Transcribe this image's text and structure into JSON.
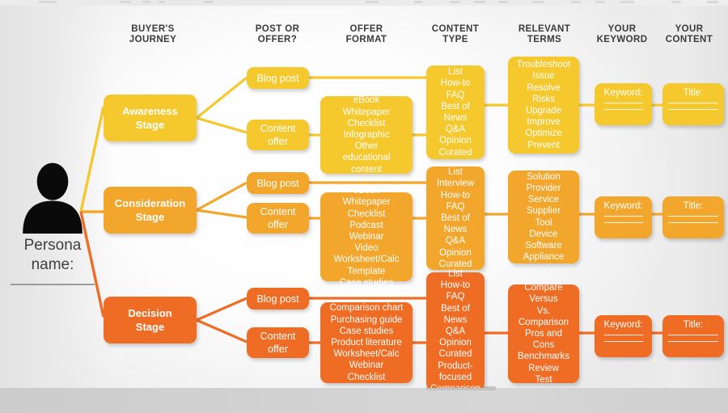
{
  "document": {
    "type": "buyer-journey-content-mapping-diagram"
  },
  "colors": {
    "awareness": "#F5C82E",
    "consideration": "#F2A72C",
    "decision": "#EE6C24",
    "header_text": "#3A3A3A",
    "persona_text": "#3F3F3F",
    "canvas": "#FFFFFF",
    "bottom_band": "#D2D2D2"
  },
  "columns": [
    {
      "id": "buyers-journey",
      "line1": "BUYER'S",
      "line2": "JOURNEY"
    },
    {
      "id": "post-or-offer",
      "line1": "POST OR",
      "line2": "OFFER?"
    },
    {
      "id": "offer-format",
      "line1": "OFFER",
      "line2": "FORMAT"
    },
    {
      "id": "content-type",
      "line1": "CONTENT",
      "line2": "TYPE"
    },
    {
      "id": "relevant-terms",
      "line1": "RELEVANT",
      "line2": "TERMS"
    },
    {
      "id": "your-keyword",
      "line1": "YOUR",
      "line2": "KEYWORD"
    },
    {
      "id": "your-content",
      "line1": "YOUR",
      "line2": "CONTENT"
    }
  ],
  "persona": {
    "icon": "person-silhouette-icon",
    "label": "Persona\nname:",
    "blank_line": ""
  },
  "rows": [
    {
      "id": "awareness",
      "stage": "Awareness\nStage",
      "post_or_offer": {
        "blog": "Blog post",
        "offer": "Content\noffer"
      },
      "offer_format": "eBook\nWhitepaper\nChecklist\nInfographic\nOther\neducational\ncontent",
      "content_type": "List\nHow-to\nFAQ\nBest of\nNews\nQ&A\nOpinion\nCurated",
      "relevant_terms": "Troubleshoot\nIssue\nResolve\nRisks\nUpgrade\nImprove\nOptimize\nPrevent",
      "your_keyword": "Keyword:",
      "your_content": "Title:"
    },
    {
      "id": "consideration",
      "stage": "Consideration\nStage",
      "post_or_offer": {
        "blog": "Blog post",
        "offer": "Content\noffer"
      },
      "offer_format": "eBook\nWhitepaper\nChecklist\nPodcast\nWebinar\nVideo\nWorksheet/Calc\nTemplate\nCase studies",
      "content_type": "List\nInterview\nHow-to\nFAQ\nBest of\nNews\nQ&A\nOpinion\nCurated",
      "relevant_terms": "Solution\nProvider\nService\nSupplier\nTool\nDevice\nSoftware\nAppliance",
      "your_keyword": "Keyword:",
      "your_content": "Title:"
    },
    {
      "id": "decision",
      "stage": "Decision\nStage",
      "post_or_offer": {
        "blog": "Blog post",
        "offer": "Content\noffer"
      },
      "offer_format": "Comparison chart\nPurchasing guide\nCase studies\nProduct literature\nWorksheet/Calc\nWebinar\nChecklist",
      "content_type": "List\nHow-to\nFAQ\nBest of\nNews\nQ&A\nOpinion\nCurated\nProduct-\nfocused\nComparison",
      "relevant_terms": "Compare\nVersus\nVs.\nComparison\nPros and\nCons\nBenchmarks\nReview\nTest",
      "your_keyword": "Keyword:",
      "your_content": "Title:"
    }
  ]
}
